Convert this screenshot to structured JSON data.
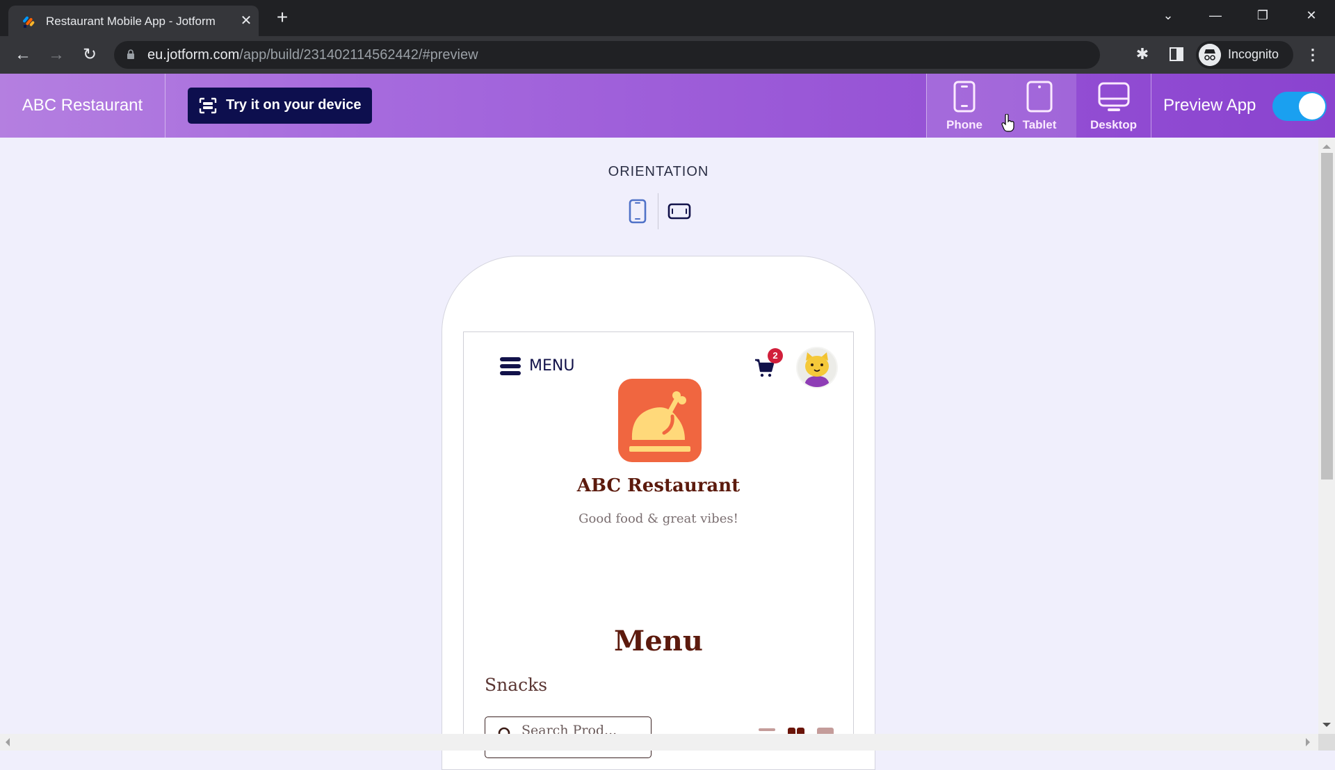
{
  "browser": {
    "tab_title": "Restaurant Mobile App - Jotform",
    "tab_close": "✕",
    "new_tab": "+",
    "url_host": "eu.jotform.com",
    "url_path": "/app/build/231402114562442/#preview",
    "profile_label": "Incognito",
    "window_controls": {
      "tab_search": "⌄",
      "minimize": "—",
      "restore": "❐",
      "close": "✕"
    },
    "nav": {
      "back": "←",
      "forward": "→",
      "reload": "↻"
    },
    "star": "☆",
    "extensions": "✱",
    "menu": "⋮"
  },
  "header": {
    "app_name": "ABC Restaurant",
    "try_button_label": "Try it on your device",
    "devices": [
      {
        "label": "Phone",
        "icon": "phone-icon",
        "selected": true
      },
      {
        "label": "Tablet",
        "icon": "tablet-icon",
        "selected": true
      },
      {
        "label": "Desktop",
        "icon": "desktop-icon",
        "selected": false
      }
    ],
    "preview_label": "Preview App",
    "preview_enabled": true,
    "colors": {
      "toggle_on": "#1aa0f0",
      "try_button_bg": "#0d0f4e",
      "header_start": "#b47fe0",
      "header_end": "#8a43cf"
    }
  },
  "orientation": {
    "label": "ORIENTATION",
    "selected": "portrait",
    "options": [
      "portrait",
      "landscape"
    ]
  },
  "app_preview": {
    "menu_label": "MENU",
    "cart_count": "2",
    "restaurant_name": "ABC Restaurant",
    "tagline": "Good food & great vibes!",
    "section_title": "Menu",
    "category": "Snacks",
    "search_placeholder": "Search Prod...",
    "view_modes": [
      "list",
      "grid-2",
      "grid-1"
    ],
    "selected_view": "grid-2",
    "colors": {
      "logo_bg": "#f06640",
      "logo_fg": "#ffd97a",
      "title": "#5c1a0d",
      "badge": "#d11f3b"
    }
  }
}
